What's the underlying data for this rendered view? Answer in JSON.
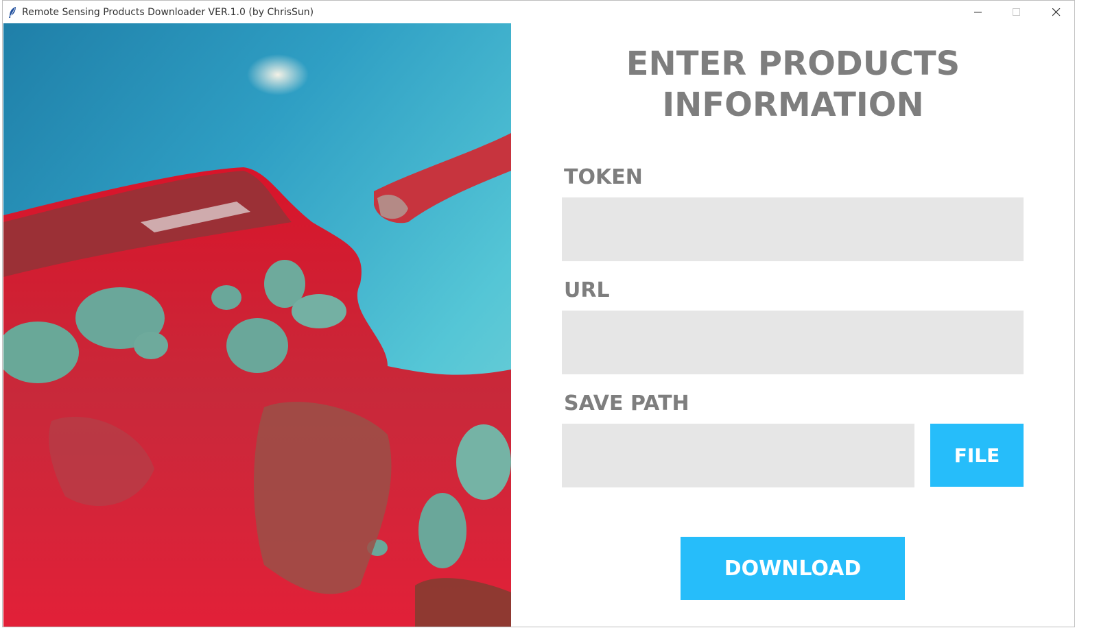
{
  "window": {
    "title": "Remote Sensing Products Downloader VER.1.0 (by ChrisSun)",
    "icon": "feather-icon",
    "controls": [
      "minimize-icon",
      "maximize-icon",
      "close-icon"
    ]
  },
  "left_panel": {
    "image": "satellite-false-color-image"
  },
  "form": {
    "heading_line1": "ENTER PRODUCTS",
    "heading_line2": "INFORMATION",
    "token_label": "TOKEN",
    "token_value": "",
    "url_label": "URL",
    "url_value": "",
    "save_path_label": "SAVE PATH",
    "save_path_value": "",
    "file_button": "FILE",
    "download_button": "DOWNLOAD"
  },
  "colors": {
    "accent": "#26bdfa",
    "label_gray": "#7e7e7e",
    "field_bg": "#e6e6e6"
  }
}
